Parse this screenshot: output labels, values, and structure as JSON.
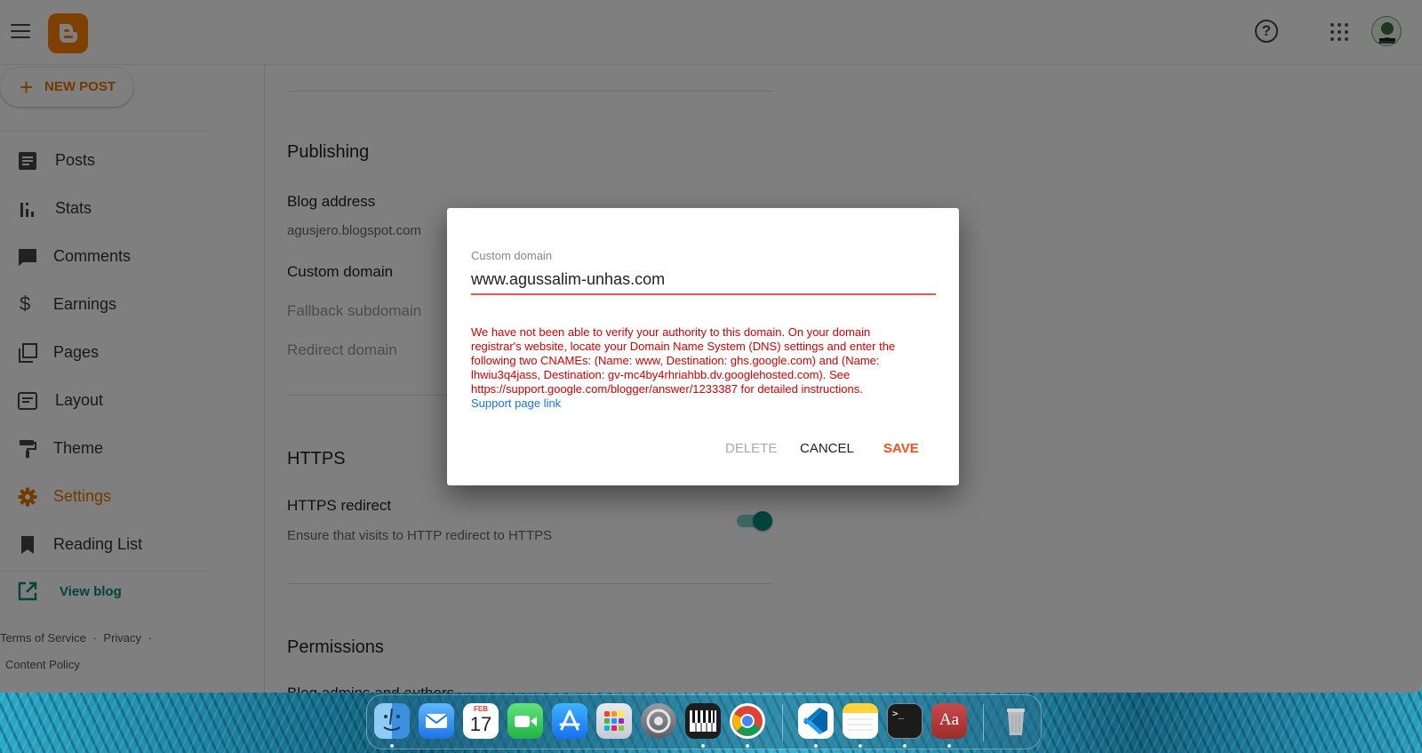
{
  "topbar": {
    "logo_letter": "B"
  },
  "sidebar": {
    "new_post_label": "NEW POST",
    "items": [
      {
        "label": "Posts",
        "icon": "posts-icon"
      },
      {
        "label": "Stats",
        "icon": "stats-icon"
      },
      {
        "label": "Comments",
        "icon": "comments-icon"
      },
      {
        "label": "Earnings",
        "icon": "dollar-icon"
      },
      {
        "label": "Pages",
        "icon": "pages-icon"
      },
      {
        "label": "Layout",
        "icon": "layout-icon"
      },
      {
        "label": "Theme",
        "icon": "paint-roller-icon"
      },
      {
        "label": "Settings",
        "icon": "gear-icon",
        "active": true
      },
      {
        "label": "Reading List",
        "icon": "bookmark-icon"
      }
    ],
    "view_blog_label": "View blog",
    "footer": {
      "terms": "Terms of Service",
      "privacy": "Privacy",
      "content_policy": "Content Policy",
      "separator": "·"
    }
  },
  "main": {
    "publishing_title": "Publishing",
    "blog_address_label": "Blog address",
    "blog_address_value": "agusjero.blogspot.com",
    "custom_domain_label": "Custom domain",
    "fallback_subdomain_label": "Fallback subdomain",
    "redirect_domain_label": "Redirect domain",
    "https_title": "HTTPS",
    "https_redirect_label": "HTTPS redirect",
    "https_redirect_desc": "Ensure that visits to HTTP redirect to HTTPS",
    "https_redirect_on": true,
    "permissions_title": "Permissions",
    "blog_admins_label": "Blog admins and authors"
  },
  "dialog": {
    "field_label": "Custom domain",
    "field_value": "www.agussalim-unhas.com",
    "error_message": "We have not been able to verify your authority to this domain. On your domain registrar's website, locate your Domain Name System (DNS) settings and enter the following two CNAMEs: (Name: www, Destination: ghs.google.com) and (Name: lhwiu3q4jass, Destination: gv-mc4by4rhriahbb.dv.googlehosted.com). See https://support.google.com/blogger/answer/1233387 for detailed instructions.",
    "support_link": "Support page link",
    "delete_label": "DELETE",
    "cancel_label": "CANCEL",
    "save_label": "SAVE"
  },
  "dock": {
    "calendar_month": "FEB",
    "calendar_day": "17",
    "dictionary_label": "Aa",
    "terminal_prompt": ">_"
  },
  "colors": {
    "accent": "#e37400",
    "teal": "#00897b",
    "error": "#d50000",
    "save": "#f4511e",
    "link": "#1a73e8"
  }
}
